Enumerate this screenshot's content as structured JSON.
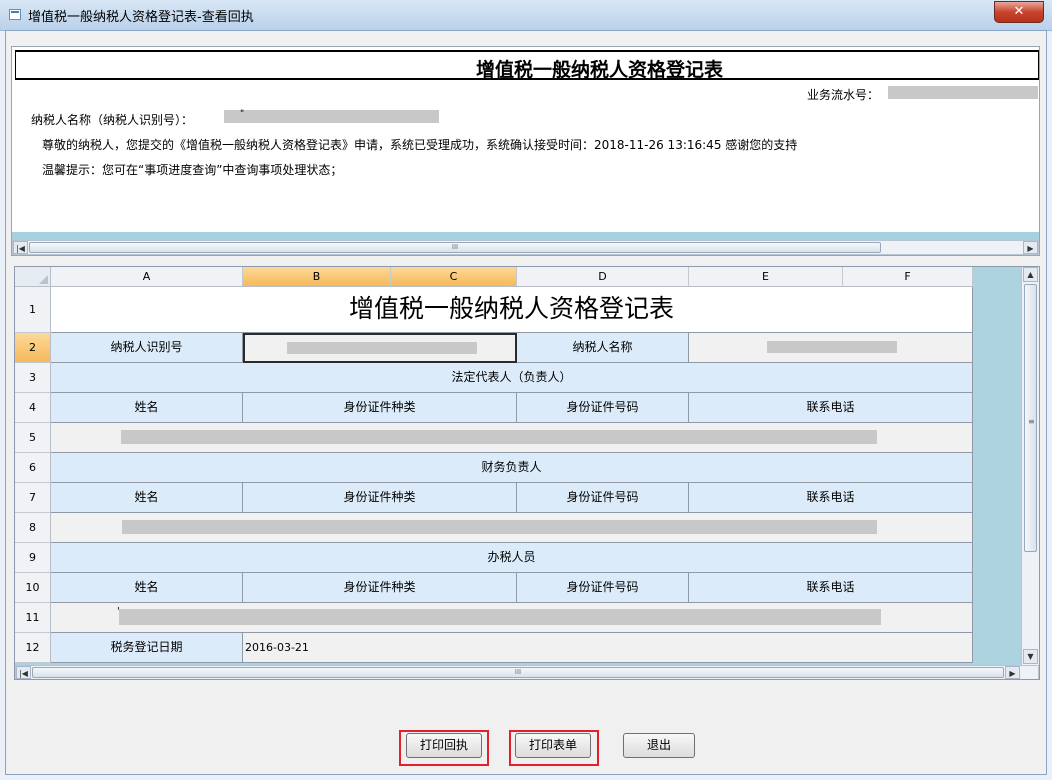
{
  "window": {
    "title": "增值税一般纳税人资格登记表-查看回执",
    "close_icon": "close-icon"
  },
  "receipt": {
    "heading": "增值税一般纳税人资格登记表",
    "serial_label": "业务流水号：",
    "taxpayer_label": "纳税人名称（纳税人识别号）：",
    "taxpayer_mark": "\"",
    "message": "尊敬的纳税人，您提交的《增值税一般纳税人资格登记表》申请，系统已受理成功，系统确认接受时间：2018-11-26   13:16:45  感谢您的支持",
    "tip": "温馨提示：您可在“事项进度查询”中查询事项处理状态；",
    "scroll_grip": "III"
  },
  "sheet": {
    "columns": [
      "A",
      "B",
      "C",
      "D",
      "E",
      "F"
    ],
    "rows": [
      "1",
      "2",
      "3",
      "4",
      "5",
      "6",
      "7",
      "8",
      "9",
      "10",
      "11",
      "12"
    ],
    "title": "增值税一般纳税人资格登记表",
    "taxpayer_id_label": "纳税人识别号",
    "taxpayer_name_label": "纳税人名称",
    "legal_rep": "法定代表人（负责人）",
    "finance_head": "财务负责人",
    "tax_officer": "办税人员",
    "col_name": "姓名",
    "col_id_type": "身份证件种类",
    "col_id_no": "身份证件号码",
    "col_phone": "联系电话",
    "reg_date_label": "税务登记日期",
    "reg_date_value": "2016-03-21",
    "row11_mark": "'",
    "scroll_grip": "III",
    "vscroll_grip": "≡"
  },
  "buttons": {
    "print_receipt": "打印回执",
    "print_form": "打印表单",
    "exit": "退出"
  },
  "colors": {
    "label_cell": "#dcebfa",
    "selected_header": "#f6b958",
    "highlight_box": "#e0202a"
  }
}
